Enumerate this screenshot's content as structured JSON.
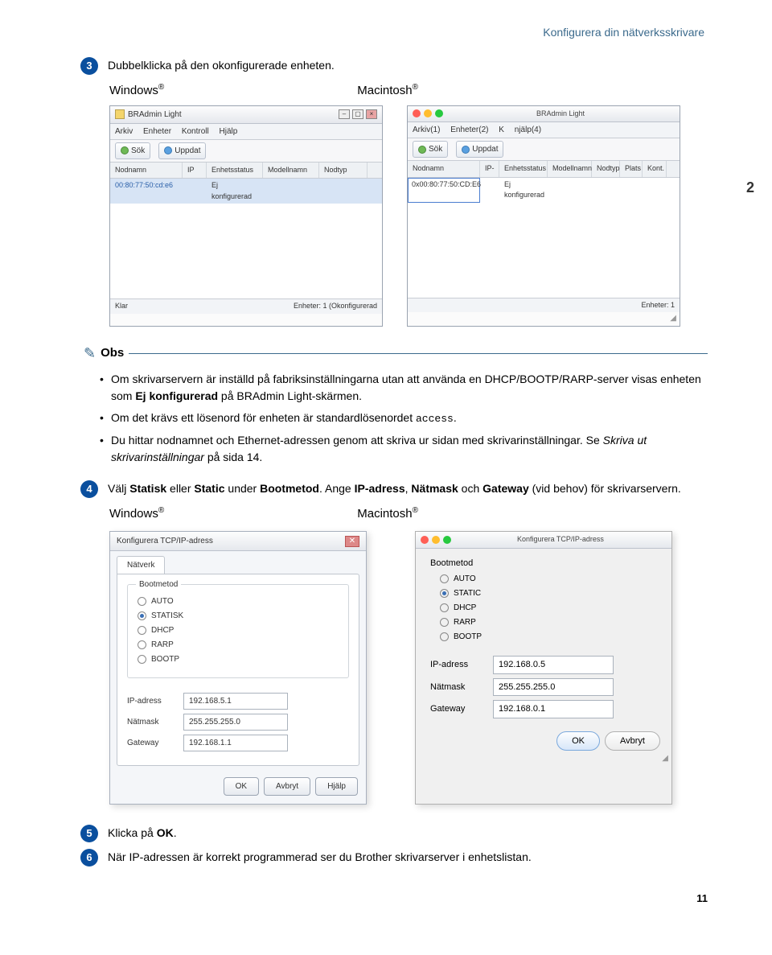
{
  "header": "Konfigurera din nätverksskrivare",
  "side_chapter": "2",
  "page_number": "11",
  "os": {
    "windows": "Windows",
    "mac": "Macintosh",
    "reg": "®"
  },
  "steps": {
    "s3": {
      "num": "3",
      "text": "Dubbelklicka på den okonfigurerade enheten."
    },
    "s4": {
      "num": "4",
      "pre": "Välj ",
      "b1": "Statisk",
      "mid1": " eller ",
      "b2": "Static",
      "mid2": " under ",
      "b3": "Bootmetod",
      "mid3": ". Ange ",
      "b4": "IP-adress",
      "mid4": ", ",
      "b5": "Nätmask",
      "mid5": " och ",
      "b6": "Gateway",
      "tail": " (vid behov) för skrivarservern."
    },
    "s5": {
      "num": "5",
      "pre": "Klicka på ",
      "b1": "OK",
      "tail": "."
    },
    "s6": {
      "num": "6",
      "text": "När IP-adressen är korrekt programmerad ser du Brother skrivarserver i enhetslistan."
    }
  },
  "obs": {
    "title": "Obs",
    "li1_pre": "Om skrivarservern är inställd på fabriksinställningarna utan att använda en DHCP/BOOTP/RARP-server visas enheten som ",
    "li1_b": "Ej konfigurerad",
    "li1_post": " på BRAdmin Light-skärmen.",
    "li2_pre": "Om det krävs ett lösenord för enheten är standardlösenordet ",
    "li2_code": "access",
    "li2_post": ".",
    "li3_pre": "Du hittar nodnamnet och Ethernet-adressen genom att skriva ur sidan med skrivarinställningar. Se ",
    "li3_i": "Skriva ut skrivarinställningar",
    "li3_post": " på sida 14."
  },
  "win_app": {
    "title": "BRAdmin Light",
    "menu": {
      "m1": "Arkiv",
      "m2": "Enheter",
      "m3": "Kontroll",
      "m4": "Hjälp"
    },
    "tools": {
      "t1": "Sök",
      "t2": "Uppdat"
    },
    "cols": {
      "c1": "Nodnamn",
      "c2": "IP",
      "c3": "Enhetsstatus",
      "c4": "Modellnamn",
      "c5": "Nodtyp"
    },
    "row": {
      "node": "00:80:77:50:cd:e6",
      "status": "Ej konfigurerad"
    },
    "status": {
      "left": "Klar",
      "right": "Enheter: 1 (Okonfigurerad"
    }
  },
  "mac_app": {
    "title": "BRAdmin Light",
    "menu": {
      "m1": "Arkiv(1)",
      "m2": "Enheter(2)",
      "m3": "K",
      "m4": "njälp(4)"
    },
    "tools": {
      "t1": "Sök",
      "t2": "Uppdat"
    },
    "cols": {
      "c1": "Nodnamn",
      "c2": "IP-",
      "c3": "Enhetsstatus",
      "c4": "Modellnamn",
      "c5": "Nodtyp",
      "c6": "Plats",
      "c7": "Kont."
    },
    "row": {
      "node": "0x00:80:77:50:CD:E6",
      "status": "Ej konfigurerad"
    },
    "status_right": "Enheter: 1"
  },
  "win_dlg": {
    "title": "Konfigurera TCP/IP-adress",
    "close": "✕",
    "tab": "Nätverk",
    "group": "Bootmetod",
    "opts": {
      "o1": "AUTO",
      "o2": "STATISK",
      "o3": "DHCP",
      "o4": "RARP",
      "o5": "BOOTP"
    },
    "fields": {
      "ip_l": "IP-adress",
      "ip_v": "192.168.5.1",
      "mask_l": "Nätmask",
      "mask_v": "255.255.255.0",
      "gw_l": "Gateway",
      "gw_v": "192.168.1.1"
    },
    "buttons": {
      "ok": "OK",
      "cancel": "Avbryt",
      "help": "Hjälp"
    }
  },
  "mac_dlg": {
    "title": "Konfigurera TCP/IP-adress",
    "group": "Bootmetod",
    "opts": {
      "o1": "AUTO",
      "o2": "STATIC",
      "o3": "DHCP",
      "o4": "RARP",
      "o5": "BOOTP"
    },
    "fields": {
      "ip_l": "IP-adress",
      "ip_v": "192.168.0.5",
      "mask_l": "Nätmask",
      "mask_v": "255.255.255.0",
      "gw_l": "Gateway",
      "gw_v": "192.168.0.1"
    },
    "buttons": {
      "ok": "OK",
      "cancel": "Avbryt"
    }
  }
}
